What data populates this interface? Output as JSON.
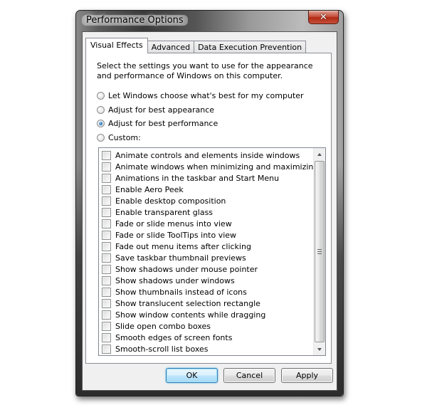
{
  "window": {
    "title": "Performance Options",
    "close_glyph": "✕"
  },
  "tabs": [
    {
      "label": "Visual Effects",
      "active": true
    },
    {
      "label": "Advanced",
      "active": false
    },
    {
      "label": "Data Execution Prevention",
      "active": false
    }
  ],
  "visual_effects": {
    "description": "Select the settings you want to use for the appearance and performance of Windows on this computer.",
    "radio_options": [
      {
        "label": "Let Windows choose what's best for my computer",
        "checked": false
      },
      {
        "label": "Adjust for best appearance",
        "checked": false
      },
      {
        "label": "Adjust for best performance",
        "checked": true
      },
      {
        "label": "Custom:",
        "checked": false
      }
    ],
    "effects": [
      {
        "label": "Animate controls and elements inside windows",
        "checked": false
      },
      {
        "label": "Animate windows when minimizing and maximizing",
        "checked": false
      },
      {
        "label": "Animations in the taskbar and Start Menu",
        "checked": false
      },
      {
        "label": "Enable Aero Peek",
        "checked": false
      },
      {
        "label": "Enable desktop composition",
        "checked": false
      },
      {
        "label": "Enable transparent glass",
        "checked": false
      },
      {
        "label": "Fade or slide menus into view",
        "checked": false
      },
      {
        "label": "Fade or slide ToolTips into view",
        "checked": false
      },
      {
        "label": "Fade out menu items after clicking",
        "checked": false
      },
      {
        "label": "Save taskbar thumbnail previews",
        "checked": false
      },
      {
        "label": "Show shadows under mouse pointer",
        "checked": false
      },
      {
        "label": "Show shadows under windows",
        "checked": false
      },
      {
        "label": "Show thumbnails instead of icons",
        "checked": false
      },
      {
        "label": "Show translucent selection rectangle",
        "checked": false
      },
      {
        "label": "Show window contents while dragging",
        "checked": false
      },
      {
        "label": "Slide open combo boxes",
        "checked": false
      },
      {
        "label": "Smooth edges of screen fonts",
        "checked": false
      },
      {
        "label": "Smooth-scroll list boxes",
        "checked": false
      }
    ]
  },
  "buttons": {
    "ok": "OK",
    "cancel": "Cancel",
    "apply": "Apply"
  },
  "colors": {
    "close_button": "#c7523d",
    "default_button": "#bee6fd",
    "radio_selected": "#2a7bc0"
  }
}
